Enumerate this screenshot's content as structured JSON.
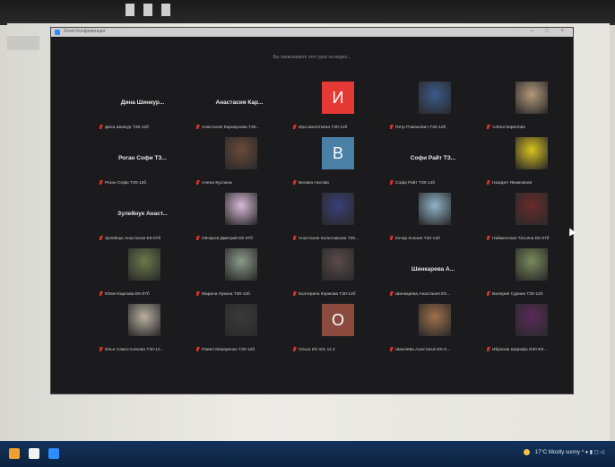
{
  "window": {
    "title": "Zoom Конференция",
    "notice": "Вы записываете этот урок на видео...",
    "controls": "– □ ×"
  },
  "participants": [
    {
      "display": "Дина Шинкур...",
      "label": "Дина Шинкур ТЗ0-12б",
      "avatar": "name",
      "color": ""
    },
    {
      "display": "Анастасия Кар...",
      "label": "Анастасия Карнаухова ТЗ0...",
      "avatar": "name",
      "color": ""
    },
    {
      "display": "И",
      "label": "Ира Шилоткина ТЗ0-12б",
      "avatar": "letter",
      "color": "#e53935"
    },
    {
      "display": "",
      "label": "Петр Романович ТЗ0-12б",
      "avatar": "photo",
      "color": "#3b5b8c"
    },
    {
      "display": "",
      "label": "Алёна Кирилова",
      "avatar": "photo",
      "color": "#b59a7a"
    },
    {
      "display": "Роган Софи ТЗ...",
      "label": "Роган Софи ТЗ0-12б",
      "avatar": "name",
      "color": ""
    },
    {
      "display": "",
      "label": "Алена Куслина",
      "avatar": "photo",
      "color": "#6b4a3a"
    },
    {
      "display": "B",
      "label": "Велика Носова",
      "avatar": "letter",
      "color": "#4a7fa6"
    },
    {
      "display": "Софи Райт ТЗ...",
      "label": "Софи Райт ТЗ0-12б",
      "avatar": "name",
      "color": ""
    },
    {
      "display": "",
      "label": "Назарет Якимовная",
      "avatar": "photo",
      "color": "#d9c21c"
    },
    {
      "display": "Зулейнук Анаст...",
      "label": "Зулейнук Анастасия ЕК-07б",
      "avatar": "name",
      "color": ""
    },
    {
      "display": "",
      "label": "Овчаров Дмитрий ЕК-07б",
      "avatar": "photo",
      "color": "#d7bad7"
    },
    {
      "display": "",
      "label": "Анастасия Колесникова ТЗ0...",
      "avatar": "photo",
      "color": "#3a3f7a"
    },
    {
      "display": "",
      "label": "Кочар Ксения ТЗ0-12б",
      "avatar": "photo",
      "color": "#8fb3c9"
    },
    {
      "display": "",
      "label": "Найменская Татьяна ЕК-07б",
      "avatar": "photo",
      "color": "#6a2a2a"
    },
    {
      "display": "",
      "label": "Юлия Карпова ЕК-07б",
      "avatar": "photo",
      "color": "#6b7a4a"
    },
    {
      "display": "",
      "label": "Марина Лукина ТЗ0-12б",
      "avatar": "photo",
      "color": "#8a9a8a"
    },
    {
      "display": "",
      "label": "Екатерина Кормова ТЗ0-12б",
      "avatar": "photo",
      "color": "#5a4a4a"
    },
    {
      "display": "Шинкарева А...",
      "label": "Шинкарева Анастасия ЕК...",
      "avatar": "name",
      "color": ""
    },
    {
      "display": "",
      "label": "Валерия Сурина ТЗ0-12б",
      "avatar": "photo",
      "color": "#7a8a5a"
    },
    {
      "display": "",
      "label": "Илья Самостьянова ТЗ0-12...",
      "avatar": "photo",
      "color": "#b8b0a0"
    },
    {
      "display": "",
      "label": "Павел Макаренко ТЗ0-12б",
      "avatar": "photo",
      "color": "#3a3a3a"
    },
    {
      "display": "О",
      "label": "Ольга ИЗ 401 11.2",
      "avatar": "letter",
      "color": "#8a4a3e"
    },
    {
      "display": "",
      "label": "Шмелёва Анастасия ЕК-0...",
      "avatar": "photo",
      "color": "#a0704a"
    },
    {
      "display": "",
      "label": "Ибрагим Шарифа ИЗ0 ЕК-...",
      "avatar": "photo",
      "color": "#5a2a5a"
    }
  ],
  "taskbar": {
    "tray_text": "17°C Mostly sunny  ^  ♦ ▮ ◻ ◁",
    "apps": [
      {
        "name": "browser-icon",
        "color": "#f0a030"
      },
      {
        "name": "files-icon",
        "color": "#f3f3f3"
      },
      {
        "name": "zoom-icon",
        "color": "#2d8cff"
      }
    ]
  }
}
